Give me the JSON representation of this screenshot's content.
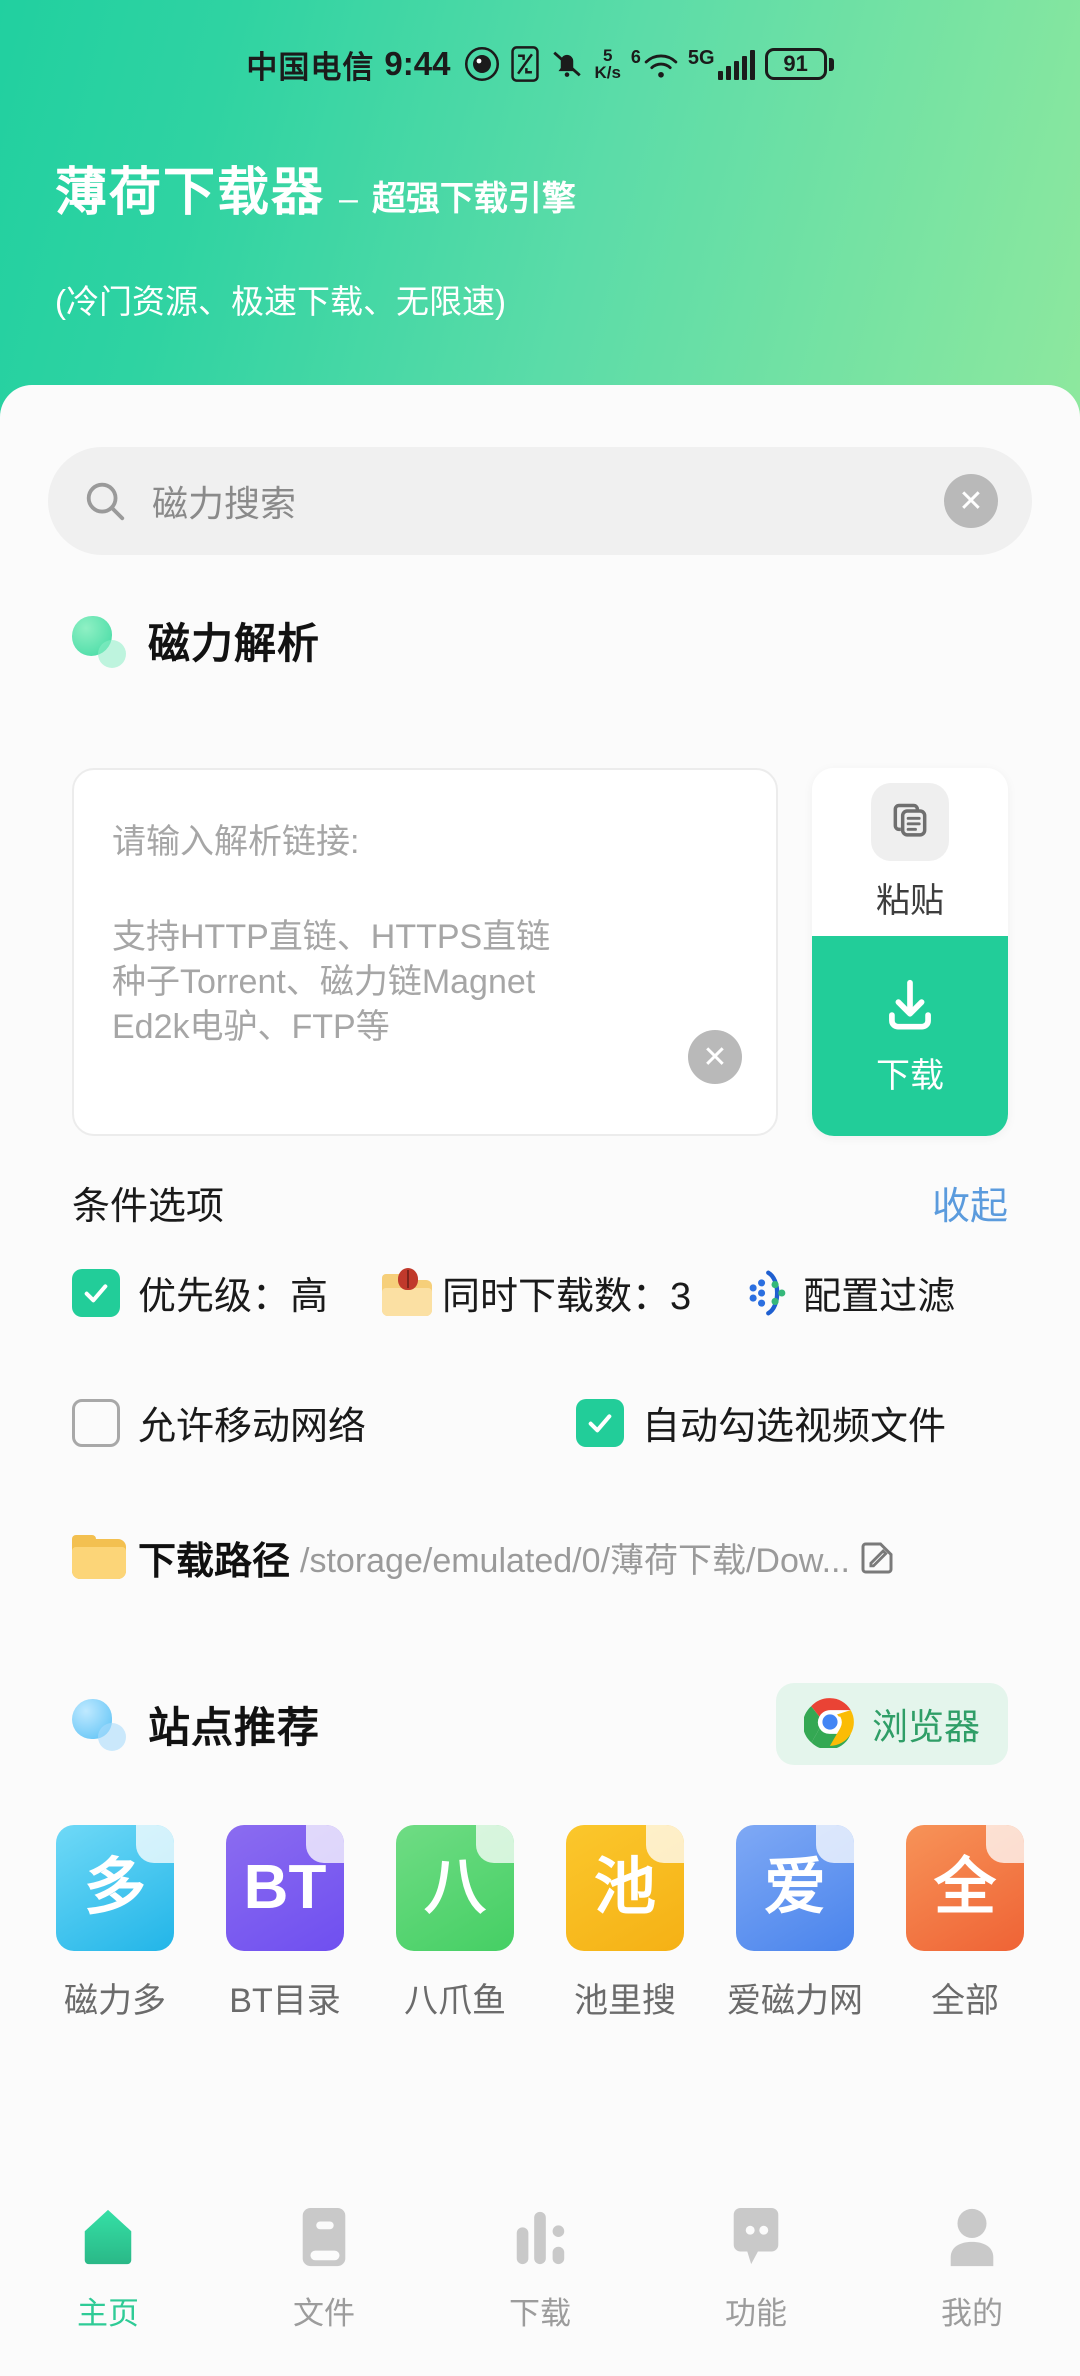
{
  "statusbar": {
    "carrier": "中国电信",
    "time": "9:44",
    "netspeed_value": "5",
    "netspeed_unit": "K/s",
    "wifi_badge": "6",
    "network_type": "5G",
    "battery": "91",
    "icons": [
      "eye-icon",
      "nfc-icon",
      "mute-bell-icon",
      "netspeed-icon",
      "wifi-icon",
      "signal-bars-icon",
      "battery-icon"
    ]
  },
  "header": {
    "app_name": "薄荷下载器",
    "dash": "–",
    "tagline": "超强下载引擎",
    "subtitle": "(冷门资源、极速下载、无限速)",
    "gradient_from": "#21d0a0",
    "gradient_to": "#8ee89e"
  },
  "search": {
    "placeholder": "磁力搜索",
    "clear_label": "✕"
  },
  "parse_section": {
    "title": "磁力解析",
    "input_label": "请输入解析链接:",
    "hint_lines": [
      "支持HTTP直链、HTTPS直链",
      "种子Torrent、磁力链Magnet",
      "Ed2k电驴、FTP等"
    ],
    "clear_label": "✕",
    "paste_label": "粘贴",
    "download_label": "下载",
    "accent_color": "#22cd99"
  },
  "options": {
    "title": "条件选项",
    "toggle_label": "收起",
    "toggle_color": "#5b9bdd",
    "row1": [
      {
        "label": "优先级：高",
        "control": "checkbox",
        "checked": true
      },
      {
        "label": "同时下载数：3",
        "control": "folder-bug-icon",
        "checked": false
      },
      {
        "label": "配置过滤",
        "control": "filter-icon",
        "checked": false
      }
    ],
    "row2": [
      {
        "label": "允许移动网络",
        "control": "checkbox",
        "checked": false
      },
      {
        "label": "自动勾选视频文件",
        "control": "checkbox",
        "checked": true
      }
    ],
    "path": {
      "label": "下载路径",
      "value": "/storage/emulated/0/薄荷下载/Dow...",
      "edit_icon": "edit-pencil-icon"
    }
  },
  "sites": {
    "title": "站点推荐",
    "browser_label": "浏览器",
    "items": [
      {
        "name": "磁力多",
        "glyph": "多",
        "color_from": "#6fd9f7",
        "color_to": "#22b5e8"
      },
      {
        "name": "BT目录",
        "glyph": "BT",
        "color_from": "#8b6cf0",
        "color_to": "#6f4ff0"
      },
      {
        "name": "八爪鱼",
        "glyph": "八",
        "color_from": "#6fdc84",
        "color_to": "#45cf64"
      },
      {
        "name": "池里搜",
        "glyph": "池",
        "color_from": "#fbc72c",
        "color_to": "#f5b115"
      },
      {
        "name": "爱磁力网",
        "glyph": "爱",
        "color_from": "#7fa9f5",
        "color_to": "#4a84ec"
      },
      {
        "name": "全部",
        "glyph": "全",
        "color_from": "#f79358",
        "color_to": "#ef6335"
      }
    ]
  },
  "tabbar": {
    "active_color": "#2fcb96",
    "inactive_color": "#9c9c9c",
    "items": [
      {
        "label": "主页",
        "icon": "home-icon",
        "active": true
      },
      {
        "label": "文件",
        "icon": "file-icon",
        "active": false
      },
      {
        "label": "下载",
        "icon": "download-bars-icon",
        "active": false
      },
      {
        "label": "功能",
        "icon": "chat-dots-icon",
        "active": false
      },
      {
        "label": "我的",
        "icon": "person-icon",
        "active": false
      }
    ]
  }
}
